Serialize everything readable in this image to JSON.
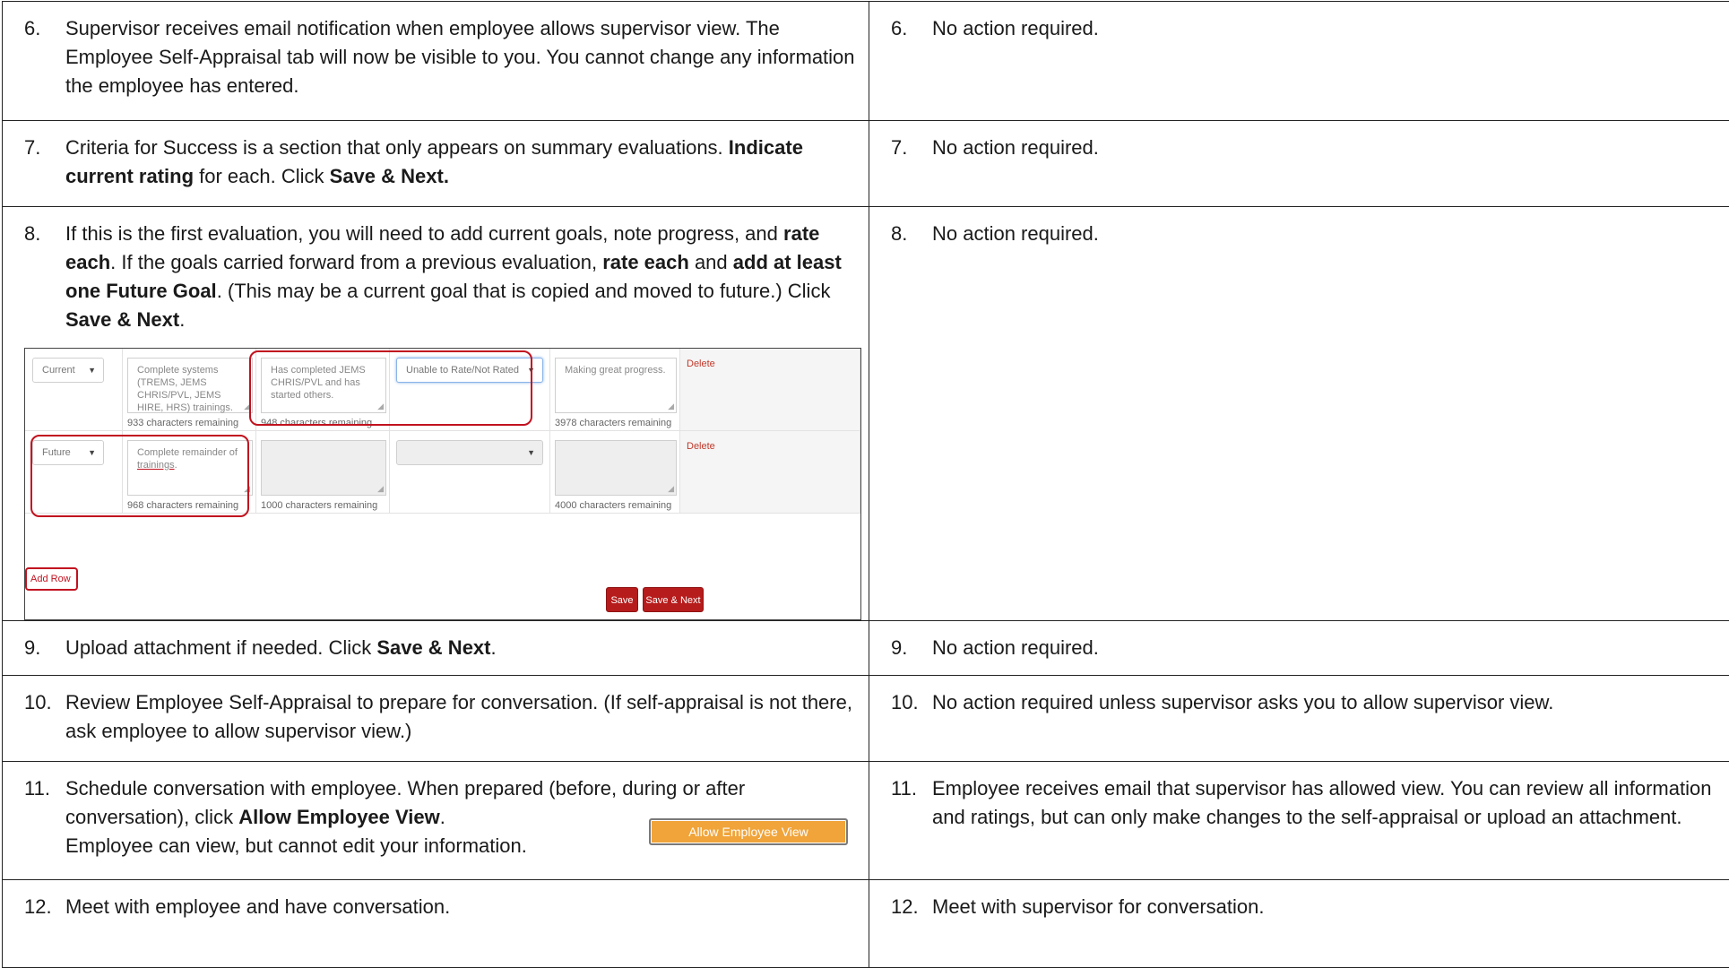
{
  "rows": [
    {
      "left": {
        "num": "6.",
        "text": "Supervisor receives email notification when employee allows supervisor view. The Employee Self-Appraisal tab will now be visible to you. You cannot change any information the employee has entered."
      },
      "right": {
        "num": "6.",
        "text": "No action required."
      }
    },
    {
      "left": {
        "num": "7.",
        "text_a": "Criteria for Success is a section that only appears on summary evaluations. ",
        "bold_a": "Indicate current rating",
        "text_b": " for each. Click ",
        "bold_b": "Save & Next."
      },
      "right": {
        "num": "7.",
        "text": "No action required."
      }
    },
    {
      "left": {
        "num": "8.",
        "text_a": "If this is the first evaluation, you will need to add current goals, note progress, and ",
        "bold_a": "rate each",
        "text_b": ". If the goals carried forward from a previous evaluation, ",
        "bold_b": "rate each",
        "text_c": " and ",
        "bold_c": "add at least one Future Goal",
        "text_d": ". (This may be a current goal that is copied and moved to future.) Click ",
        "bold_d": "Save & Next",
        "text_e": "."
      },
      "right": {
        "num": "8.",
        "text": "No action required."
      }
    },
    {
      "left": {
        "num": "9.",
        "text_a": "Upload attachment if needed. Click ",
        "bold_a": "Save & Next",
        "text_b": "."
      },
      "right": {
        "num": "9.",
        "text": "No action required."
      }
    },
    {
      "left": {
        "num": "10.",
        "text": "Review Employee Self-Appraisal to prepare for conversation. (If self-appraisal is not there, ask employee to allow supervisor view.)"
      },
      "right": {
        "num": "10.",
        "text": "No action required unless supervisor asks you to allow supervisor view."
      }
    },
    {
      "left": {
        "num": "11.",
        "text_a": "Schedule conversation with employee. When prepared (before, during or after conversation), click ",
        "bold_a": "Allow Employee View",
        "text_b": ".",
        "line3": "Employee can view, but cannot edit your information."
      },
      "right": {
        "num": "11.",
        "text": "Employee receives email that supervisor has allowed view. You can review all information and ratings, but can only make changes to the self-appraisal or upload an attachment."
      }
    },
    {
      "left": {
        "num": "12.",
        "text": "Meet with employee and have conversation."
      },
      "right": {
        "num": "12.",
        "text": "Meet with supervisor for conversation."
      }
    }
  ],
  "screenshot": {
    "row1": {
      "type": "Current",
      "goal": "Complete systems (TREMS, JEMS CHRIS/PVL, JEMS HIRE, HRS) trainings.",
      "goal_remaining": "933 characters remaining",
      "progress": "Has completed JEMS CHRIS/PVL and has started others.",
      "progress_remaining": "948 characters remaining",
      "rating": "Unable to Rate/Not Rated",
      "comment": "Making great progress.",
      "comment_remaining": "3978 characters remaining",
      "delete": "Delete"
    },
    "row2": {
      "type": "Future",
      "goal_a": "Complete remainder of ",
      "goal_b": "trainings",
      "goal_c": ".",
      "goal_remaining": "968 characters remaining",
      "progress_remaining": "1000 characters remaining",
      "comment_remaining": "4000 characters remaining",
      "delete": "Delete"
    },
    "add_row": "Add Row",
    "save": "Save",
    "save_next": "Save & Next"
  },
  "allow_button": "Allow Employee View",
  "icons": {
    "dropdown": "caret-down-icon",
    "resize": "resize-grip-icon"
  },
  "colors": {
    "highlight": "#c1121f",
    "button_red": "#b71c1c",
    "allow_orange": "#f0a43a"
  }
}
